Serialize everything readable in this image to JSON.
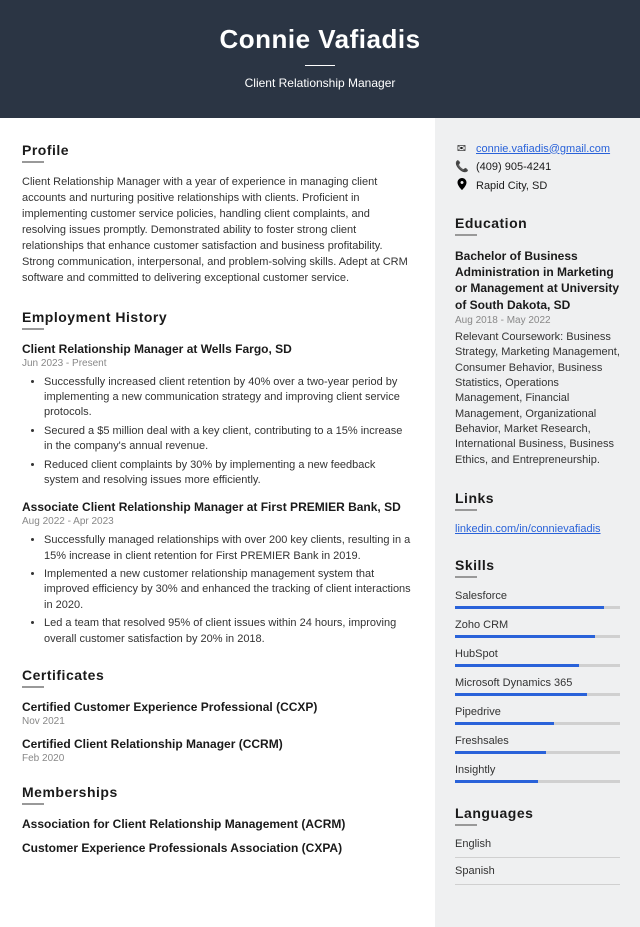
{
  "header": {
    "name": "Connie Vafiadis",
    "title": "Client Relationship Manager"
  },
  "profile": {
    "heading": "Profile",
    "text": "Client Relationship Manager with a year of experience in managing client accounts and nurturing positive relationships with clients. Proficient in implementing customer service policies, handling client complaints, and resolving issues promptly. Demonstrated ability to foster strong client relationships that enhance customer satisfaction and business profitability. Strong communication, interpersonal, and problem-solving skills. Adept at CRM software and committed to delivering exceptional customer service."
  },
  "employment": {
    "heading": "Employment History",
    "jobs": [
      {
        "title": "Client Relationship Manager at Wells Fargo, SD",
        "dates": "Jun 2023 - Present",
        "bullets": [
          "Successfully increased client retention by 40% over a two-year period by implementing a new communication strategy and improving client service protocols.",
          "Secured a $5 million deal with a key client, contributing to a 15% increase in the company's annual revenue.",
          "Reduced client complaints by 30% by implementing a new feedback system and resolving issues more efficiently."
        ]
      },
      {
        "title": "Associate Client Relationship Manager at First PREMIER Bank, SD",
        "dates": "Aug 2022 - Apr 2023",
        "bullets": [
          "Successfully managed relationships with over 200 key clients, resulting in a 15% increase in client retention for First PREMIER Bank in 2019.",
          "Implemented a new customer relationship management system that improved efficiency by 30% and enhanced the tracking of client interactions in 2020.",
          "Led a team that resolved 95% of client issues within 24 hours, improving overall customer satisfaction by 20% in 2018."
        ]
      }
    ]
  },
  "certificates": {
    "heading": "Certificates",
    "items": [
      {
        "name": "Certified Customer Experience Professional (CCXP)",
        "date": "Nov 2021"
      },
      {
        "name": "Certified Client Relationship Manager (CCRM)",
        "date": "Feb 2020"
      }
    ]
  },
  "memberships": {
    "heading": "Memberships",
    "items": [
      "Association for Client Relationship Management (ACRM)",
      "Customer Experience Professionals Association (CXPA)"
    ]
  },
  "contact": {
    "email": "connie.vafiadis@gmail.com",
    "phone": "(409) 905-4241",
    "location": "Rapid City, SD"
  },
  "education": {
    "heading": "Education",
    "degree": "Bachelor of Business Administration in Marketing or Management at University of South Dakota, SD",
    "dates": "Aug 2018 - May 2022",
    "desc": "Relevant Coursework: Business Strategy, Marketing Management, Consumer Behavior, Business Statistics, Operations Management, Financial Management, Organizational Behavior, Market Research, International Business, Business Ethics, and Entrepreneurship."
  },
  "links": {
    "heading": "Links",
    "url": "linkedin.com/in/connievafiadis"
  },
  "skills": {
    "heading": "Skills",
    "items": [
      {
        "name": "Salesforce",
        "level": 90
      },
      {
        "name": "Zoho CRM",
        "level": 85
      },
      {
        "name": "HubSpot",
        "level": 75
      },
      {
        "name": "Microsoft Dynamics 365",
        "level": 80
      },
      {
        "name": "Pipedrive",
        "level": 60
      },
      {
        "name": "Freshsales",
        "level": 55
      },
      {
        "name": "Insightly",
        "level": 50
      }
    ]
  },
  "languages": {
    "heading": "Languages",
    "items": [
      "English",
      "Spanish"
    ]
  }
}
